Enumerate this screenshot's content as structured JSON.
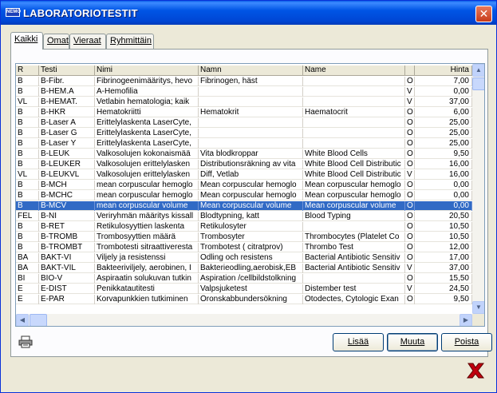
{
  "window": {
    "title": "LABORATORIOTESTIT",
    "icon": "app-icon",
    "icon_text": "NEMO",
    "close_label": "✕"
  },
  "tabs": [
    {
      "label": "Kaikki",
      "active": true
    },
    {
      "label": "Omat",
      "active": false
    },
    {
      "label": "Vieraat",
      "active": false
    },
    {
      "label": "Ryhmittäin",
      "active": false
    }
  ],
  "table": {
    "columns": [
      "R",
      "Testi",
      "Nimi",
      "Namn",
      "Name",
      "",
      "Hinta"
    ],
    "rows": [
      [
        "B",
        "B-Fibr.",
        "Fibrinogeenimääritys, hevo",
        "Fibrinogen, häst",
        "",
        "O",
        "7,00"
      ],
      [
        "B",
        "B-HEM.A",
        "A-Hemofilia",
        "",
        "",
        "V",
        "0,00"
      ],
      [
        "VL",
        "B-HEMAT.",
        "Vetlabin hematologia; kaik",
        "",
        "",
        "V",
        "37,00"
      ],
      [
        "B",
        "B-HKR",
        "Hematokriitti",
        "Hematokrit",
        "Haematocrit",
        "O",
        "6,00"
      ],
      [
        "B",
        "B-Laser A",
        "Erittelylaskenta LaserCyte,",
        "",
        "",
        "O",
        "25,00"
      ],
      [
        "B",
        "B-Laser G",
        "Erittelylaskenta LaserCyte,",
        "",
        "",
        "O",
        "25,00"
      ],
      [
        "B",
        "B-Laser Y",
        "Erittelylaskenta LaserCyte,",
        "",
        "",
        "O",
        "25,00"
      ],
      [
        "B",
        "B-LEUK",
        "Valkosolujen kokonaismää",
        "Vita blodkroppar",
        "White Blood Cells",
        "O",
        "9,50"
      ],
      [
        "B",
        "B-LEUKER",
        "Valkosolujen erittelylasken",
        "Distributionsräkning av vita",
        "White Blood Cell Distributic",
        "O",
        "16,00"
      ],
      [
        "VL",
        "B-LEUKVL",
        "Valkosolujen erittelylasken",
        "Diff, Vetlab",
        "White Blood Cell Distributic",
        "V",
        "16,00"
      ],
      [
        "B",
        "B-MCH",
        "mean corpuscular hemoglo",
        "Mean corpuscular hemoglo",
        "Mean corpuscular hemoglo",
        "O",
        "0,00"
      ],
      [
        "B",
        "B-MCHC",
        "mean corpuscular hemoglo",
        "Mean corpuscular hemoglo",
        "Mean corpuscular hemoglo",
        "O",
        "0,00"
      ],
      [
        "B",
        "B-MCV",
        "mean corpuscular volume",
        "Mean corpuscular volume",
        "Mean corpuscular volume",
        "O",
        "0,00"
      ],
      [
        "FEL",
        "B-NI",
        "Veriryhmän määritys kissall",
        "Blodtypning, katt",
        "Blood Typing",
        "O",
        "20,50"
      ],
      [
        "B",
        "B-RET",
        "Retikulosyyttien laskenta",
        "Retikulosyter",
        "",
        "O",
        "10,50"
      ],
      [
        "B",
        "B-TROMB",
        "Trombosyyttien määrä",
        "Trombosyter",
        "Thrombocytes (Platelet Co",
        "O",
        "10,50"
      ],
      [
        "B",
        "B-TROMBT",
        "Trombotesti sitraattiveresta",
        "Trombotest ( citratprov)",
        "Thrombo Test",
        "O",
        "12,00"
      ],
      [
        "BA",
        "BAKT-VI",
        "Viljely ja resistenssi",
        "Odling och resistens",
        "Bacterial Antibiotic Sensitiv",
        "O",
        "17,00"
      ],
      [
        "BA",
        "BAKT-VIL",
        "Bakteeriviljely, aerobinen, I",
        "Bakterieodling,aerobisk,EB",
        "Bacterial Antibiotic Sensitiv",
        "V",
        "37,00"
      ],
      [
        "BI",
        "BIO-V",
        "Aspiraatin solukuvan tutkin",
        "Aspiration /cellbildstolkning",
        "",
        "O",
        "15,50"
      ],
      [
        "E",
        "E-DIST",
        "Penikkatautitesti",
        "Valpsjuketest",
        "Distember test",
        "V",
        "24,50"
      ],
      [
        "E",
        "E-PAR",
        "Korvapunkkien tutkiminen",
        "Öronskabbundersökning",
        "Otodectes, Cytologic Exan",
        "O",
        "9,50"
      ]
    ],
    "selected_row": 12
  },
  "buttons": {
    "add": "Lisää",
    "edit": "Muuta",
    "delete": "Poista"
  },
  "icons": {
    "print": "printer-icon",
    "exit": "exit-x-icon"
  },
  "colors": {
    "title_bar": "#0055e5",
    "selection": "#316ac5",
    "exit_x": "#c0000f"
  }
}
